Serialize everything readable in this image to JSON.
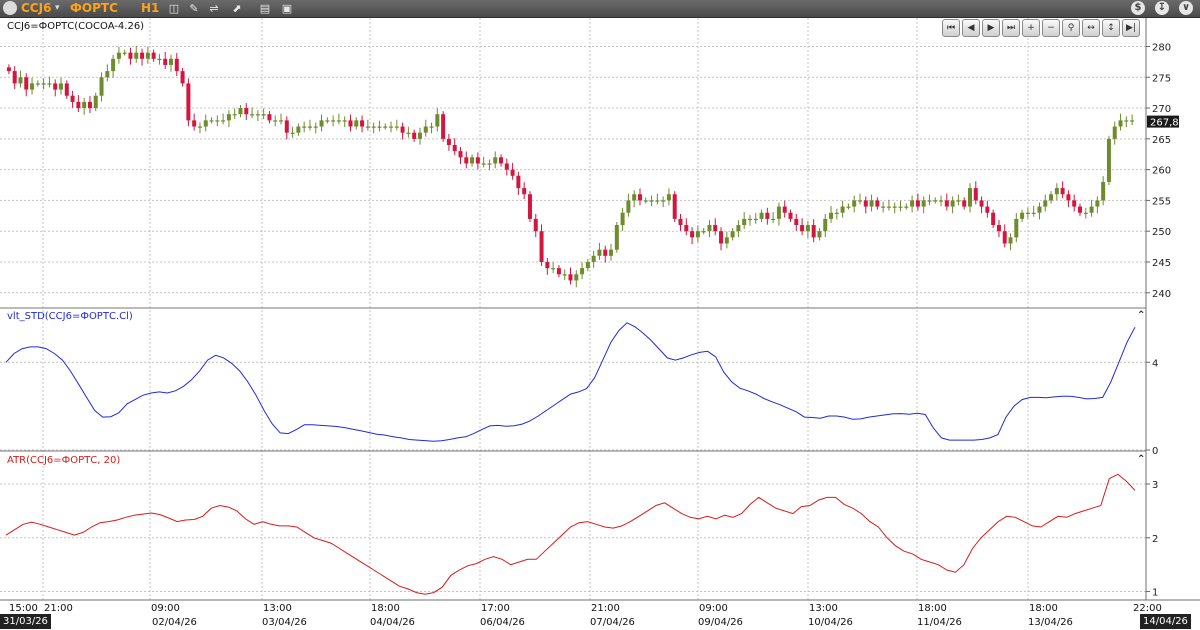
{
  "toolbar": {
    "symbol": "CCJ6",
    "exchange": "ФОРТС",
    "timeframe": "H1",
    "icons": [
      "bar-chart-icon",
      "pencil-icon",
      "indicators-icon",
      "cursor-icon",
      "template-icon",
      "close-icon"
    ],
    "right_icons": [
      "dollar-icon",
      "download-icon",
      "chevron-down-icon"
    ]
  },
  "price_panel": {
    "title": "CCJ6=ФОРТС(COCOA-4.26)",
    "ylim": [
      238.5,
      283.0
    ],
    "ticks": [
      240,
      245,
      250,
      255,
      260,
      265,
      270,
      275,
      280
    ],
    "tick_labels": [
      "240",
      "245",
      "250",
      "255",
      "260",
      "265",
      "270",
      "275",
      "280"
    ],
    "last_price_label": "267,8",
    "last_price": 267.8,
    "colors": {
      "up": "#6e8b2d",
      "down": "#d3163f",
      "grid": "#b9b9b9"
    },
    "nav_buttons": [
      "first-icon",
      "prev-page-icon",
      "next-page-icon",
      "last-icon",
      "zoom-in-icon",
      "zoom-out-icon",
      "zoom-fit-icon",
      "expand-icon",
      "shrink-icon",
      "goto-end-icon"
    ]
  },
  "std_panel": {
    "title": "vlt_STD(CCJ6=ФОРТС.Cl)",
    "color": "#1f2bd6",
    "ylim": [
      0,
      5.7
    ],
    "ticks": [
      0,
      4
    ],
    "tick_labels": [
      "0",
      "4"
    ]
  },
  "atr_panel": {
    "title": "ATR(CCJ6=ФОРТС, 20)",
    "color": "#d41c1c",
    "ylim": [
      0.88,
      3.26
    ],
    "ticks": [
      1,
      2,
      3
    ],
    "tick_labels": [
      "1",
      "2",
      "3"
    ]
  },
  "time_axis": {
    "labels": [
      "15:00",
      "21:00",
      "09:00",
      "13:00",
      "18:00",
      "17:00",
      "21:00",
      "09:00",
      "13:00",
      "18:00",
      "18:00",
      "22:00"
    ],
    "date_labels": [
      "31/03/26",
      "02/04/26",
      "03/04/26",
      "04/04/26",
      "06/04/26",
      "07/04/26",
      "09/04/26",
      "10/04/26",
      "11/04/26",
      "13/04/26",
      "14/04/26"
    ]
  },
  "chart_data": [
    {
      "type": "candlestick",
      "title": "CCJ6=ФОРТС(COCOA-4.26)",
      "ylim": [
        238.5,
        283.0
      ],
      "close": [
        276,
        274,
        275,
        273,
        274,
        274,
        274,
        274,
        273,
        274,
        272,
        271,
        270,
        271,
        270,
        272,
        275,
        276,
        278,
        279,
        279,
        278,
        279,
        278,
        279,
        278,
        278,
        277,
        278,
        276,
        274,
        268,
        267,
        267,
        268,
        268,
        268,
        268,
        269,
        269,
        270,
        269,
        269,
        269,
        269,
        268,
        268,
        268,
        266,
        266,
        267,
        267,
        267,
        267,
        268,
        268,
        268,
        268,
        268,
        267,
        268,
        267,
        267,
        267,
        267,
        267,
        267,
        267,
        266,
        266,
        265,
        266,
        267,
        267,
        269,
        265,
        264,
        263,
        262,
        261,
        262,
        261,
        261,
        261,
        262,
        261,
        260,
        259,
        257,
        256,
        252,
        250,
        245,
        244,
        244,
        243,
        243,
        242,
        243,
        244,
        245,
        246,
        247,
        246,
        247,
        251,
        253,
        255,
        256,
        255,
        255,
        255,
        255,
        255,
        256,
        252,
        251,
        250,
        249,
        250,
        250,
        251,
        250,
        248,
        249,
        250,
        251,
        252,
        252,
        252,
        253,
        252,
        252,
        254,
        253,
        252,
        251,
        250,
        251,
        249,
        250,
        252,
        253,
        253,
        254,
        254,
        255,
        255,
        254,
        255,
        254,
        254,
        254,
        254,
        254,
        254,
        255,
        254,
        255,
        255,
        255,
        255,
        254,
        255,
        255,
        254,
        257,
        255,
        254,
        253,
        251,
        250,
        248,
        249,
        252,
        253,
        253,
        253,
        254,
        255,
        256,
        257,
        256,
        255,
        254,
        253,
        253,
        254,
        255,
        258,
        265,
        267,
        268,
        268,
        268
      ],
      "rows": 195
    },
    {
      "type": "line",
      "title": "vlt_STD(CCJ6=ФОРТС.Cl)",
      "ylim": [
        0,
        5.7
      ],
      "series": [
        {
          "values": [
            4.0,
            4.4,
            4.62,
            4.7,
            4.7,
            4.62,
            4.4,
            4.1,
            3.6,
            3.0,
            2.4,
            1.8,
            1.5,
            1.52,
            1.7,
            2.1,
            2.3,
            2.5,
            2.6,
            2.65,
            2.6,
            2.7,
            2.9,
            3.2,
            3.6,
            4.1,
            4.32,
            4.2,
            3.95,
            3.6,
            3.1,
            2.5,
            1.8,
            1.2,
            0.78,
            0.75,
            0.93,
            1.15,
            1.15,
            1.12,
            1.1,
            1.07,
            1.02,
            0.95,
            0.88,
            0.8,
            0.72,
            0.68,
            0.6,
            0.55,
            0.48,
            0.45,
            0.43,
            0.4,
            0.42,
            0.48,
            0.55,
            0.6,
            0.75,
            0.93,
            1.1,
            1.12,
            1.08,
            1.11,
            1.18,
            1.33,
            1.55,
            1.8,
            2.05,
            2.3,
            2.55,
            2.65,
            2.8,
            3.3,
            4.1,
            4.9,
            5.45,
            5.8,
            5.62,
            5.33,
            5.0,
            4.6,
            4.2,
            4.1,
            4.2,
            4.34,
            4.45,
            4.5,
            4.25,
            3.55,
            3.1,
            2.82,
            2.7,
            2.55,
            2.35,
            2.2,
            2.06,
            1.9,
            1.74,
            1.5,
            1.48,
            1.45,
            1.55,
            1.55,
            1.5,
            1.4,
            1.42,
            1.5,
            1.55,
            1.6,
            1.65,
            1.66,
            1.63,
            1.68,
            1.62,
            1.0,
            0.55,
            0.45,
            0.45,
            0.45,
            0.45,
            0.48,
            0.55,
            0.7,
            1.5,
            2.0,
            2.3,
            2.4,
            2.4,
            2.38,
            2.42,
            2.45,
            2.45,
            2.4,
            2.33,
            2.35,
            2.4,
            3.1,
            4.0,
            4.9,
            5.6
          ]
        }
      ]
    },
    {
      "type": "line",
      "title": "ATR(CCJ6=ФОРТС, 20)",
      "ylim": [
        0.88,
        3.26
      ],
      "series": [
        {
          "values": [
            2.05,
            2.15,
            2.25,
            2.29,
            2.25,
            2.2,
            2.15,
            2.1,
            2.05,
            2.1,
            2.2,
            2.28,
            2.3,
            2.33,
            2.38,
            2.42,
            2.44,
            2.46,
            2.43,
            2.37,
            2.3,
            2.33,
            2.34,
            2.4,
            2.55,
            2.6,
            2.57,
            2.5,
            2.35,
            2.25,
            2.3,
            2.25,
            2.22,
            2.22,
            2.2,
            2.1,
            2.0,
            1.95,
            1.9,
            1.8,
            1.7,
            1.6,
            1.5,
            1.4,
            1.3,
            1.2,
            1.1,
            1.05,
            0.98,
            0.95,
            0.98,
            1.08,
            1.3,
            1.4,
            1.48,
            1.52,
            1.6,
            1.65,
            1.6,
            1.5,
            1.55,
            1.6,
            1.6,
            1.75,
            1.9,
            2.05,
            2.2,
            2.28,
            2.3,
            2.25,
            2.2,
            2.18,
            2.22,
            2.3,
            2.4,
            2.5,
            2.6,
            2.65,
            2.55,
            2.45,
            2.38,
            2.35,
            2.4,
            2.35,
            2.42,
            2.38,
            2.45,
            2.62,
            2.75,
            2.65,
            2.55,
            2.5,
            2.45,
            2.58,
            2.6,
            2.7,
            2.75,
            2.75,
            2.62,
            2.55,
            2.45,
            2.3,
            2.2,
            2.0,
            1.85,
            1.75,
            1.7,
            1.6,
            1.55,
            1.5,
            1.4,
            1.36,
            1.5,
            1.8,
            2.0,
            2.15,
            2.3,
            2.4,
            2.38,
            2.3,
            2.22,
            2.2,
            2.3,
            2.4,
            2.38,
            2.45,
            2.5,
            2.55,
            2.6,
            3.1,
            3.18,
            3.05,
            2.88
          ]
        }
      ]
    }
  ]
}
